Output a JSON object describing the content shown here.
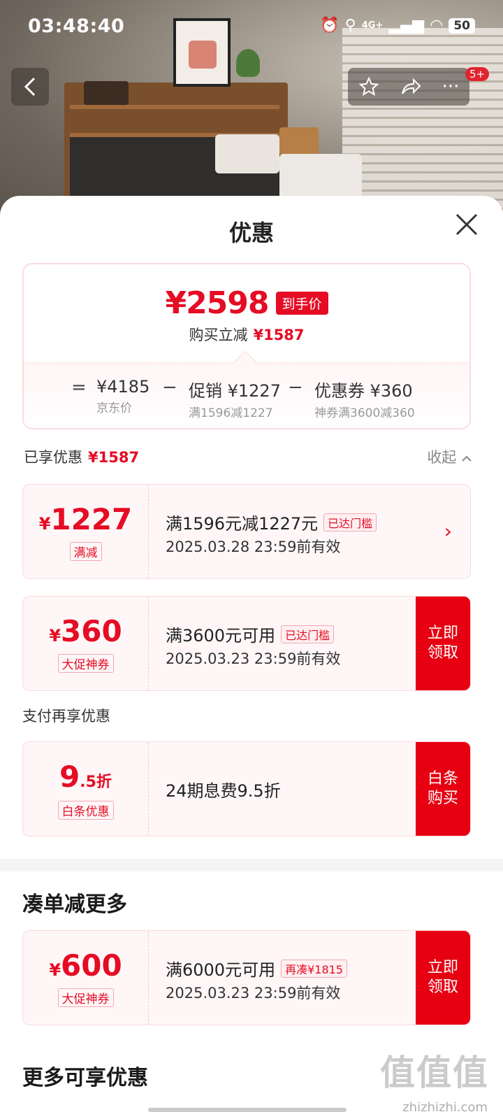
{
  "status_bar": {
    "time": "03:48:40",
    "network": "4G+",
    "battery": "50"
  },
  "top_nav": {
    "message_badge": "5+"
  },
  "sheet": {
    "title": "优惠",
    "summary": {
      "final_price": "¥2598",
      "final_tag": "到手价",
      "save_label": "购买立减",
      "save_amount": "¥1587",
      "formula": {
        "eq": "=",
        "minus": "−",
        "jd_value": "¥4185",
        "jd_desc": "京东价",
        "promo_value": "促销 ¥1227",
        "promo_desc": "满1596减1227",
        "coupon_value": "优惠券 ¥360",
        "coupon_desc": "神券满3600减360"
      }
    },
    "enjoyed": {
      "label": "已享优惠",
      "amount": "¥1587",
      "collapse": "收起"
    },
    "coupons": [
      {
        "currency": "¥",
        "amount": "1227",
        "kind": "满减",
        "line1": "满1596元减1227元",
        "pill": "已达门槛",
        "line2": "2025.03.28 23:59前有效"
      },
      {
        "currency": "¥",
        "amount": "360",
        "kind": "大促神券",
        "line1": "满3600元可用",
        "pill": "已达门槛",
        "line2": "2025.03.23 23:59前有效",
        "cta": "立即领取"
      }
    ],
    "pay_section": {
      "label": "支付再享优惠",
      "amount_big": "9",
      "amount_small": ".5折",
      "kind": "白条优惠",
      "line1": "24期息费9.5折",
      "cta": "白条购买"
    },
    "more_section": {
      "title": "凑单减更多",
      "coupon": {
        "currency": "¥",
        "amount": "600",
        "kind": "大促神券",
        "line1": "满6000元可用",
        "pill": "再凑¥1815",
        "line2": "2025.03.23 23:59前有效",
        "cta": "立即领取"
      }
    },
    "more_enjoy_title": "更多可享优惠"
  },
  "watermark": {
    "text": "值值值",
    "url": "zhizhizhi.com"
  },
  "colors": {
    "accent_red": "#e50c24",
    "cta_red": "#e60012"
  },
  "icons": {
    "back": "chevron-left-icon",
    "favorite": "star-icon",
    "share": "share-icon",
    "more": "more-icon",
    "close": "close-icon",
    "collapse": "chevron-up-icon",
    "coupon_arrow": "chevron-right-icon"
  }
}
